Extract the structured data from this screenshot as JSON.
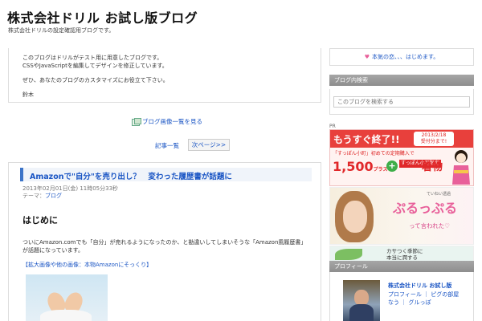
{
  "header": {
    "title": "株式会社ドリル お試し版ブログ",
    "description": "株式会社ドリルの設定確認用ブログです。"
  },
  "intro": {
    "line1": "このブログはドリルがテスト用に用意したブログです。",
    "line2": "CSSやJavaScriptを編集してデザインを修正しています。",
    "line3": "ぜひ、あなたのブログのカスタマイズにお役立て下さい。",
    "signature": "鈴木"
  },
  "image_list_link": "ブログ画像一覧を見る",
  "pager": {
    "list_label": "記事一覧",
    "next_label": "次ページ>>"
  },
  "post": {
    "title": "Amazonで\"自分\"を売り出し？　変わった履歴書が話題に",
    "date": "2013年02月01日(金) 11時05分33秒",
    "theme_label": "テーマ：",
    "theme_value": "ブログ",
    "heading": "はじめに",
    "body_line1": "ついにAmazon.comでも「自分」が売れるようになったのか、と勘違いしてしまいそうな「Amazon風履歴書」",
    "body_line2": "が話題になっています。",
    "image_link": "【拡大画像や他の画像：本物Amazonにそっくり】"
  },
  "sidebar": {
    "notice": "本気の恋、、、はじめます。",
    "search_heading": "ブログ内検索",
    "search_placeholder": "このブログを検索する",
    "pr_label": "PR",
    "ad1": {
      "title": "もうすぐ終了!!",
      "date_line1": "2013/2/18",
      "date_line2": "受付分まで!",
      "subtitle": "「すっぽん小町」初めての定期購入で",
      "price": "1,500",
      "price_unit": "プラス",
      "limited": "すっぽん小町限定",
      "kimono": "着物"
    },
    "ad2": {
      "small_text": "ていねい透過",
      "title": "ぷるっぷる",
      "subtitle": "って言われた♡"
    },
    "ad3": {
      "line1": "カサつく季節に",
      "line2": "本当に潤する"
    },
    "profile_heading": "プロフィール",
    "profile_name": "株式会社ドリル お試し版",
    "profile_links_line1": "プロフィール ｜ ピグの部屋",
    "profile_links_line2": "なう ｜ グルっぽ"
  },
  "colors": {
    "link": "#1a55c4",
    "accent_red": "#e0282a",
    "accent_pink": "#e8609a",
    "heading_bg": "#999999"
  }
}
